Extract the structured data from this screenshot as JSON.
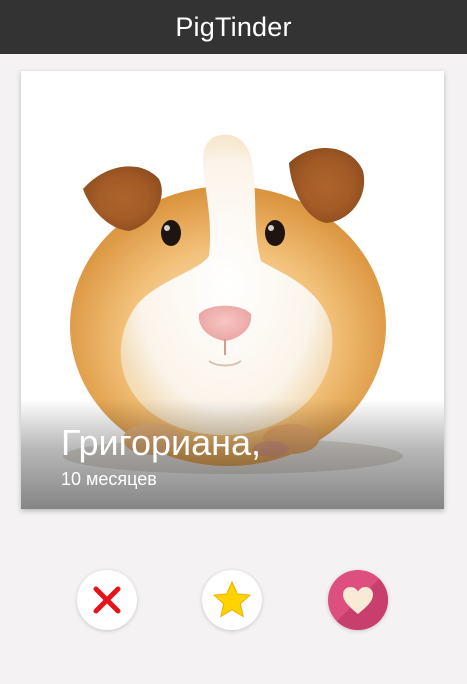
{
  "app": {
    "title": "PigTinder"
  },
  "profile": {
    "name": "Григориана,",
    "age": "10 месяцев",
    "photo_subject": "guinea pig"
  },
  "actions": [
    {
      "id": "nope",
      "icon": "close-icon",
      "color": "#e8141c"
    },
    {
      "id": "superlike",
      "icon": "star-icon",
      "color": "#ffd200"
    },
    {
      "id": "like",
      "icon": "heart-icon",
      "color": "#dc4f7f"
    }
  ],
  "colors": {
    "topbar": "#333333",
    "background": "#f4f2f3",
    "like_button": "#dc4f7f",
    "heart": "#f8ead7"
  }
}
